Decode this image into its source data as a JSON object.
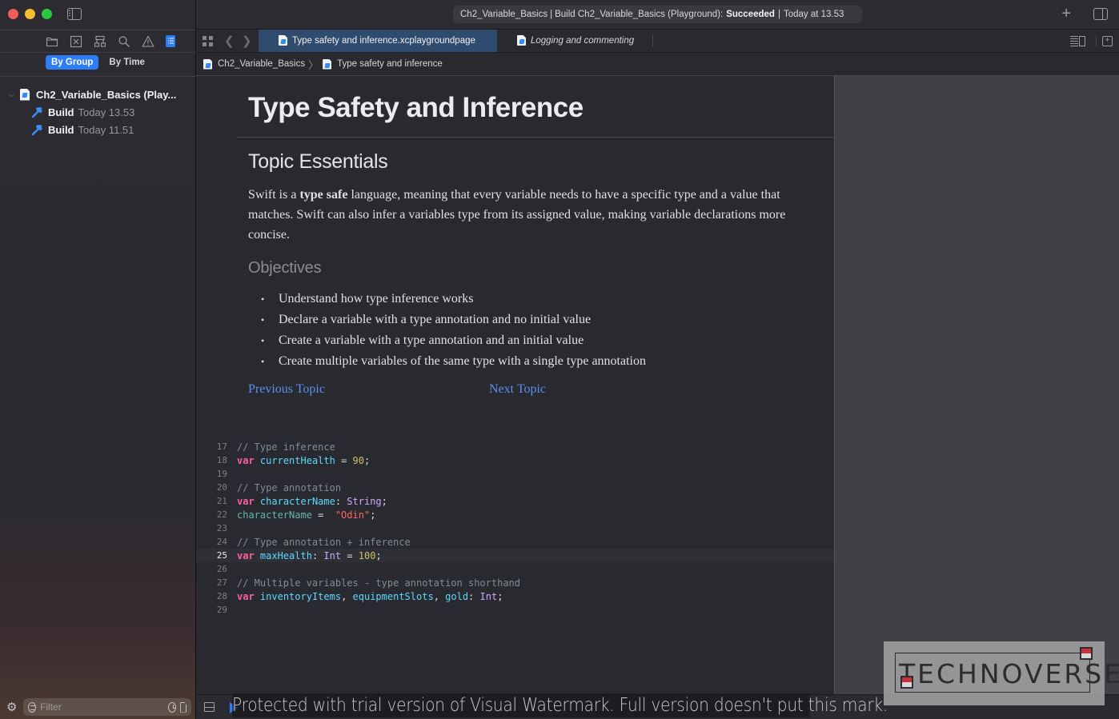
{
  "window": {
    "activity": {
      "project": "Ch2_Variable_Basics",
      "action": "Build Ch2_Variable_Basics (Playground):",
      "status": "Succeeded",
      "time": "Today at 13.53"
    },
    "add_button": "+"
  },
  "sidebar": {
    "navigator_icons": [
      "folder-icon",
      "source-control-icon",
      "symbol-hierarchy-icon",
      "find-icon",
      "issue-warning-icon",
      "report-icon"
    ],
    "segments": [
      {
        "label": "By Group",
        "active": true
      },
      {
        "label": "By Time",
        "active": false
      }
    ],
    "tree": {
      "root": "Ch2_Variable_Basics (Play...",
      "children": [
        {
          "label": "Build",
          "time": "Today 13.53"
        },
        {
          "label": "Build",
          "time": "Today 11.51"
        }
      ]
    },
    "filter": {
      "placeholder": "Filter",
      "value": ""
    }
  },
  "tabs": [
    {
      "label": "Type safety and inference.xcplaygroundpage",
      "active": true
    },
    {
      "label": "Logging and commenting",
      "active": false
    }
  ],
  "breadcrumb": [
    "Ch2_Variable_Basics",
    "Type safety and inference"
  ],
  "doc": {
    "title": "Type Safety and Inference",
    "section": "Topic Essentials",
    "paragraph_pre": "Swift is a ",
    "paragraph_bold": "type safe",
    "paragraph_post": " language, meaning that every variable needs to have a specific type and a value that matches. Swift can also infer a variables type from its assigned value, making variable declarations more concise.",
    "objectives_heading": "Objectives",
    "objectives": [
      "Understand how type inference works",
      "Declare a variable with a type annotation and no initial value",
      "Create a variable with a type annotation and an initial value",
      "Create multiple variables of the same type with a single type annotation"
    ],
    "prev_link": "Previous Topic",
    "next_link": "Next Topic"
  },
  "code": {
    "current_line": 25,
    "lines": [
      {
        "n": "17",
        "tokens": [
          [
            "com",
            "// Type inference"
          ]
        ]
      },
      {
        "n": "18",
        "tokens": [
          [
            "kw",
            "var"
          ],
          [
            "plain",
            " "
          ],
          [
            "id",
            "currentHealth"
          ],
          [
            "plain",
            " = "
          ],
          [
            "num",
            "90"
          ],
          [
            "plain",
            ";"
          ]
        ]
      },
      {
        "n": "19",
        "tokens": []
      },
      {
        "n": "20",
        "tokens": [
          [
            "com",
            "// Type annotation"
          ]
        ]
      },
      {
        "n": "21",
        "tokens": [
          [
            "kw",
            "var"
          ],
          [
            "plain",
            " "
          ],
          [
            "id",
            "characterName"
          ],
          [
            "plain",
            ": "
          ],
          [
            "type",
            "String"
          ],
          [
            "plain",
            ";"
          ]
        ]
      },
      {
        "n": "22",
        "tokens": [
          [
            "id2",
            "characterName"
          ],
          [
            "plain",
            " =  "
          ],
          [
            "str",
            "\"Odin\""
          ],
          [
            "plain",
            ";"
          ]
        ]
      },
      {
        "n": "23",
        "tokens": []
      },
      {
        "n": "24",
        "tokens": [
          [
            "com",
            "// Type annotation + inference"
          ]
        ]
      },
      {
        "n": "25",
        "tokens": [
          [
            "kw",
            "var"
          ],
          [
            "plain",
            " "
          ],
          [
            "id",
            "maxHealth"
          ],
          [
            "plain",
            ": "
          ],
          [
            "type",
            "Int"
          ],
          [
            "plain",
            " = "
          ],
          [
            "num",
            "100"
          ],
          [
            "plain",
            ";"
          ]
        ]
      },
      {
        "n": "26",
        "tokens": []
      },
      {
        "n": "27",
        "tokens": [
          [
            "com",
            "// Multiple variables - type annotation shorthand"
          ]
        ]
      },
      {
        "n": "28",
        "tokens": [
          [
            "kw",
            "var"
          ],
          [
            "plain",
            " "
          ],
          [
            "id",
            "inventoryItems"
          ],
          [
            "plain",
            ", "
          ],
          [
            "id",
            "equipmentSlots"
          ],
          [
            "plain",
            ", "
          ],
          [
            "id",
            "gold"
          ],
          [
            "plain",
            ": "
          ],
          [
            "type",
            "Int"
          ],
          [
            "plain",
            ";"
          ]
        ]
      },
      {
        "n": "29",
        "tokens": []
      }
    ]
  },
  "watermark": {
    "notice": "Protected with trial version of Visual Watermark. Full version doesn't put this mark.",
    "logo": "TECHNOVERSE"
  },
  "colors": {
    "accent": "#2e7cf6",
    "active_tab": "#2f4b6e",
    "link": "#5a8ff0",
    "keyword": "#fc5fa3",
    "identifier": "#5dd8ff",
    "type": "#d0a8ff",
    "number": "#d0bf69",
    "string": "#fc6a5d",
    "comment": "#7f8c98"
  }
}
